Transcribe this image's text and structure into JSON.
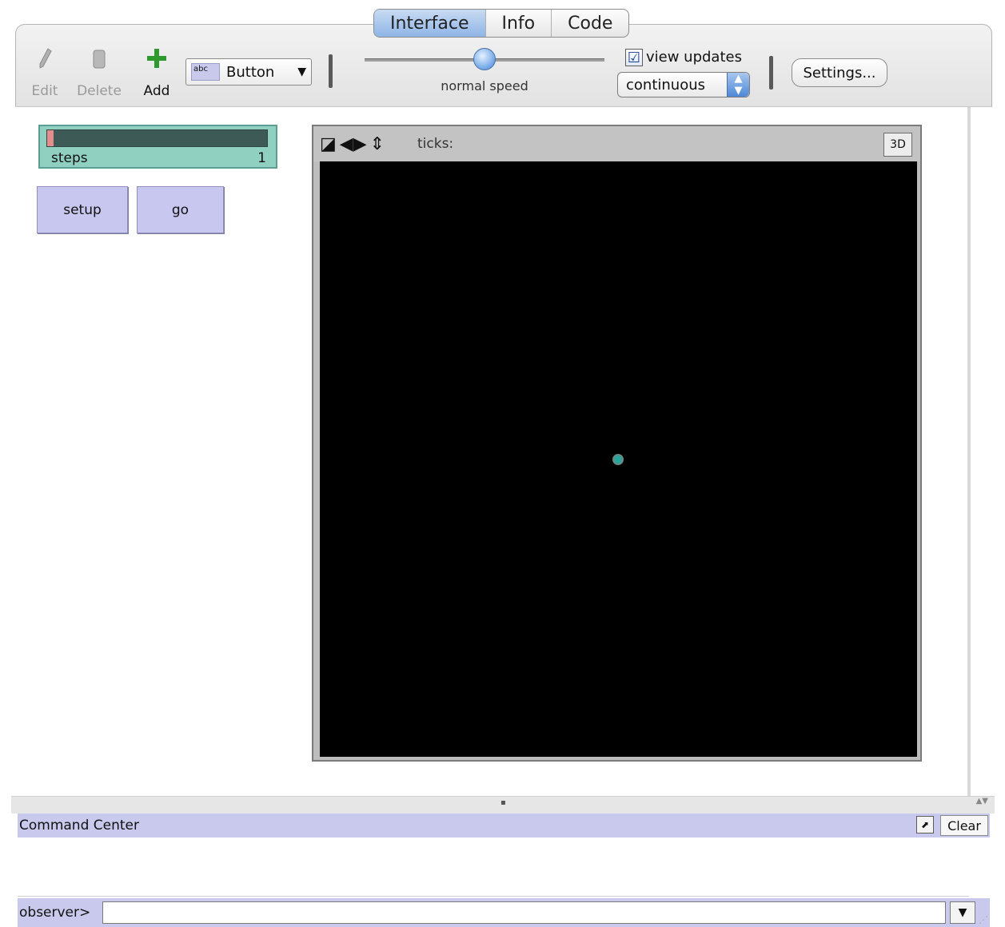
{
  "tabs": [
    {
      "label": "Interface",
      "active": true
    },
    {
      "label": "Info",
      "active": false
    },
    {
      "label": "Code",
      "active": false
    }
  ],
  "toolbar": {
    "edit_label": "Edit",
    "delete_label": "Delete",
    "add_label": "Add",
    "widget_type": "Button",
    "widget_type_icon_text": "abc",
    "speed_label": "normal speed",
    "speed_value": 0.5,
    "view_updates_label": "view updates",
    "view_updates_checked": "☑",
    "update_mode": "continuous",
    "settings_label": "Settings..."
  },
  "monitor": {
    "label": "steps",
    "value": "1",
    "fill_fraction": 0.03
  },
  "buttons": {
    "setup_label": "setup",
    "go_label": "go"
  },
  "view": {
    "ticks_label": "ticks:",
    "three_d_label": "3D",
    "background_color": "#000000",
    "turtle_color": "#2ca39c"
  },
  "command_center": {
    "title": "Command Center",
    "clear_label": "Clear",
    "agent_prompt": "observer>",
    "input_value": ""
  }
}
